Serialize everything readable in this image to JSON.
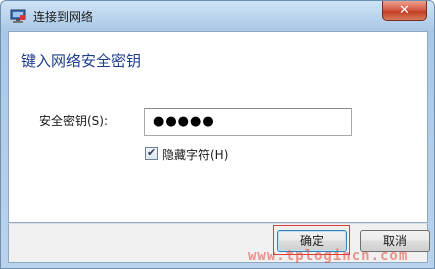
{
  "window": {
    "title": "连接到网络"
  },
  "titlebar": {
    "close_glyph": "✕",
    "icon": "network-icon"
  },
  "dialog": {
    "heading": "键入网络安全密钥",
    "key_label": "安全密钥(S):",
    "key_value": "●●●●●",
    "hide_chars_label": "隐藏字符(H)",
    "hide_chars_checked": true
  },
  "buttons": {
    "ok": "确定",
    "cancel": "取消"
  },
  "watermark": "www.tplogincn.com",
  "colors": {
    "heading": "#1e3d8f",
    "highlight_outline": "#e03a3a",
    "watermark": "#e24a3a"
  }
}
